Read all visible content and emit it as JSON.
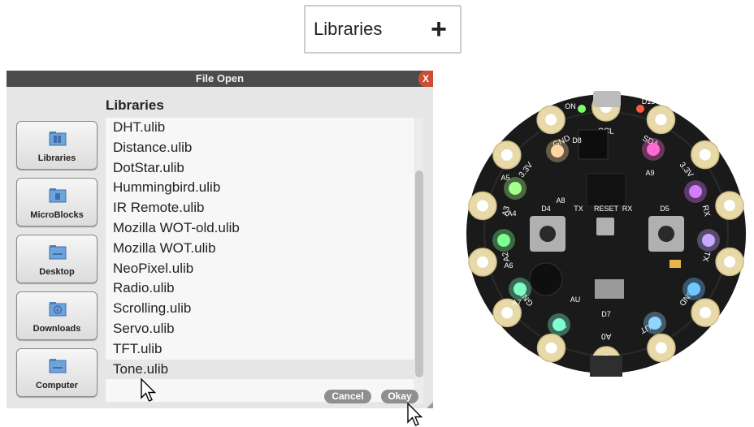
{
  "libraries_button": {
    "label": "Libraries",
    "plus_icon": "plus-icon"
  },
  "dialog": {
    "title": "File Open",
    "close_label": "X",
    "folder_title": "Libraries",
    "locations": [
      {
        "label": "Libraries",
        "icon": "libraries-folder-icon"
      },
      {
        "label": "MicroBlocks",
        "icon": "microblocks-folder-icon"
      },
      {
        "label": "Desktop",
        "icon": "desktop-folder-icon"
      },
      {
        "label": "Downloads",
        "icon": "downloads-folder-icon"
      },
      {
        "label": "Computer",
        "icon": "computer-folder-icon"
      }
    ],
    "files": [
      "DHT.ulib",
      "Distance.ulib",
      "DotStar.ulib",
      "Hummingbird.ulib",
      "IR Remote.ulib",
      "Mozilla WOT-old.ulib",
      "Mozilla WOT.ulib",
      "NeoPixel.ulib",
      "Radio.ulib",
      "Scrolling.ulib",
      "Servo.ulib",
      "TFT.ulib",
      "Tone.ulib"
    ],
    "cancel_label": "Cancel",
    "okay_label": "Okay"
  },
  "board": {
    "pad_labels": [
      "GND",
      "SCL",
      "SDA",
      "3.3V",
      "RX",
      "TX",
      "GND",
      "VOUT",
      "A0",
      "A1",
      "GND",
      "A2",
      "A3",
      "3.3V"
    ],
    "silk_labels": [
      "D13",
      "D8",
      "A9",
      "A8",
      "D4",
      "D5",
      "RESET",
      "TX",
      "RX",
      "D7",
      "A6",
      "A7",
      "A5",
      "A4",
      "AU",
      "ON"
    ]
  },
  "colors": {
    "titlebar": "#4c4c4c",
    "close": "#cc4d33",
    "board": "#1a1a1a",
    "pad": "#e8d9a8"
  }
}
